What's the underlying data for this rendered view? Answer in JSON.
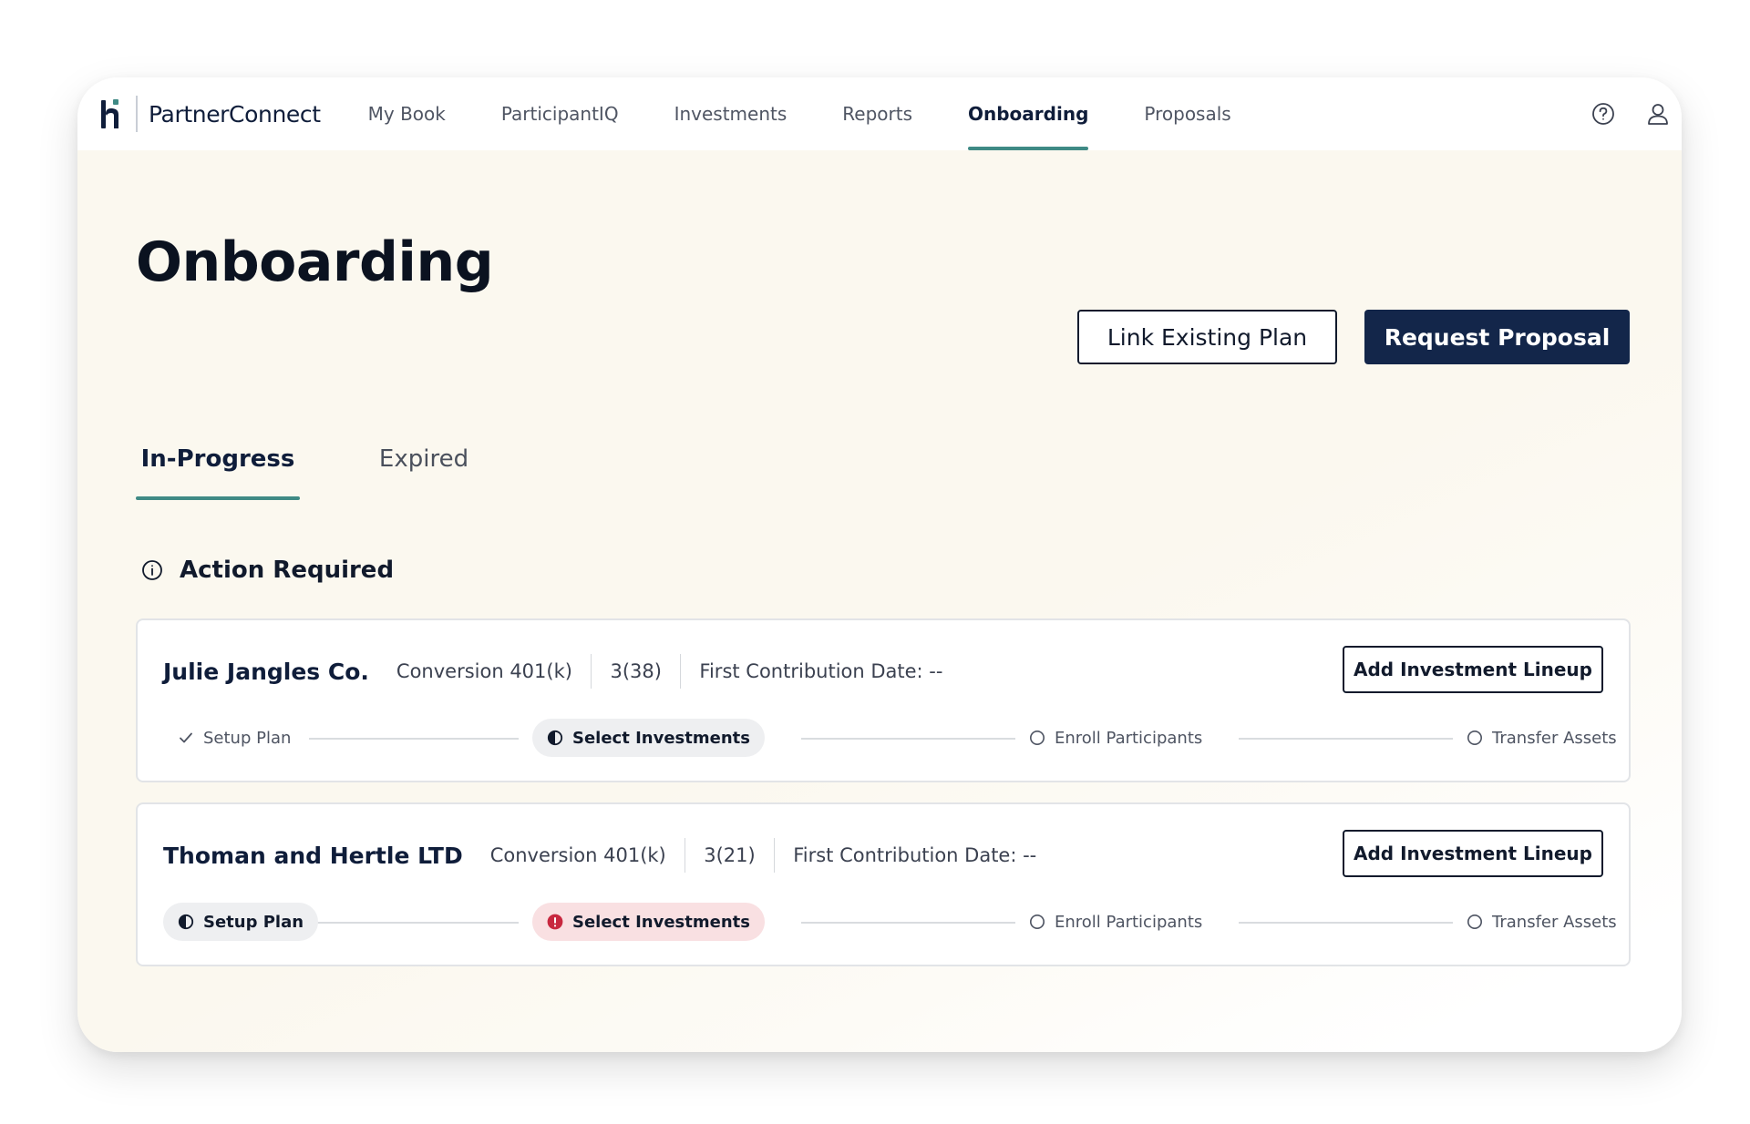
{
  "brand": {
    "name": "PartnerConnect",
    "color": "#0f1d3a"
  },
  "nav": {
    "items": [
      {
        "label": "My Book",
        "active": false
      },
      {
        "label": "ParticipantIQ",
        "active": false
      },
      {
        "label": "Investments",
        "active": false
      },
      {
        "label": "Reports",
        "active": false
      },
      {
        "label": "Onboarding",
        "active": true
      },
      {
        "label": "Proposals",
        "active": false
      }
    ],
    "icons": [
      "help-icon",
      "user-icon"
    ],
    "accent": "#3f8a85"
  },
  "page": {
    "title": "Onboarding",
    "buttons": {
      "link_existing": "Link Existing Plan",
      "request_proposal": "Request Proposal"
    },
    "primary_color": "#13264a"
  },
  "tabs": [
    {
      "label": "In-Progress",
      "active": true
    },
    {
      "label": "Expired",
      "active": false
    }
  ],
  "section": {
    "title": "Action Required",
    "icon": "info-icon"
  },
  "cards": [
    {
      "client": "Julie Jangles Co.",
      "plan_type": "Conversion 401(k)",
      "count": "3(38)",
      "first_contribution": "First Contribution Date: --",
      "action_label": "Add Investment Lineup",
      "steps": [
        {
          "label": "Setup Plan",
          "status": "complete"
        },
        {
          "label": "Select Investments",
          "status": "in-progress"
        },
        {
          "label": "Enroll Participants",
          "status": "pending"
        },
        {
          "label": "Transfer Assets",
          "status": "pending"
        }
      ]
    },
    {
      "client": "Thoman and Hertle LTD",
      "plan_type": "Conversion 401(k)",
      "count": "3(21)",
      "first_contribution": "First Contribution Date: --",
      "action_label": "Add Investment Lineup",
      "steps": [
        {
          "label": "Setup Plan",
          "status": "in-progress"
        },
        {
          "label": "Select Investments",
          "status": "error"
        },
        {
          "label": "Enroll Participants",
          "status": "pending"
        },
        {
          "label": "Transfer Assets",
          "status": "pending"
        }
      ]
    }
  ],
  "status_colors": {
    "error": "#c8283f",
    "error_bg": "#f9e0e2",
    "pill_bg": "#eeeff1"
  }
}
